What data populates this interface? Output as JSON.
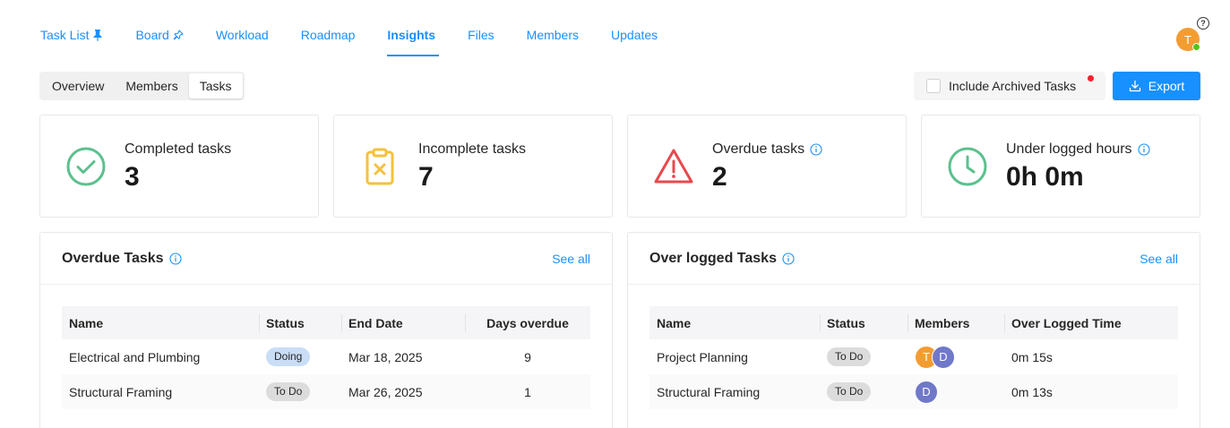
{
  "nav": {
    "tabs": [
      {
        "label": "Task List",
        "pinned": true,
        "pin_style": "solid"
      },
      {
        "label": "Board",
        "pinned": true,
        "pin_style": "outline"
      },
      {
        "label": "Workload"
      },
      {
        "label": "Roadmap"
      },
      {
        "label": "Insights",
        "active": true
      },
      {
        "label": "Files"
      },
      {
        "label": "Members"
      },
      {
        "label": "Updates"
      }
    ],
    "help_glyph": "?",
    "user_initial": "T"
  },
  "segments": {
    "items": [
      "Overview",
      "Members",
      "Tasks"
    ],
    "active": "Tasks"
  },
  "toolbar": {
    "archived_label": "Include Archived Tasks",
    "archived_checked": false,
    "export_label": "Export"
  },
  "stats": [
    {
      "label": "Completed tasks",
      "value": "3",
      "icon": "check-circle-icon",
      "color": "#5cc08e",
      "info": false
    },
    {
      "label": "Incomplete tasks",
      "value": "7",
      "icon": "clipboard-x-icon",
      "color": "#f5c13c",
      "info": false
    },
    {
      "label": "Overdue tasks",
      "value": "2",
      "icon": "warning-triangle-icon",
      "color": "#e8484d",
      "info": true
    },
    {
      "label": "Under logged hours",
      "value": "0h 0m",
      "icon": "clock-icon",
      "color": "#5cc08e",
      "info": true
    }
  ],
  "overdue_panel": {
    "title": "Overdue Tasks",
    "see_all": "See all",
    "columns": [
      "Name",
      "Status",
      "End Date",
      "Days overdue"
    ],
    "rows": [
      {
        "name": "Electrical and Plumbing",
        "status": "Doing",
        "end_date": "Mar 18, 2025",
        "days": "9"
      },
      {
        "name": "Structural Framing",
        "status": "To Do",
        "end_date": "Mar 26, 2025",
        "days": "1"
      }
    ]
  },
  "overlogged_panel": {
    "title": "Over logged Tasks",
    "see_all": "See all",
    "columns": [
      "Name",
      "Status",
      "Members",
      "Over Logged Time"
    ],
    "rows": [
      {
        "name": "Project Planning",
        "status": "To Do",
        "members": [
          {
            "initial": "T",
            "color": "#f39c32"
          },
          {
            "initial": "D",
            "color": "#7078c9"
          }
        ],
        "time": "0m 15s"
      },
      {
        "name": "Structural Framing",
        "status": "To Do",
        "members": [
          {
            "initial": "D",
            "color": "#7078c9"
          }
        ],
        "time": "0m 13s"
      }
    ]
  },
  "colors": {
    "accent": "#1890ff",
    "online": "#52c41a",
    "notification": "#f5222d"
  }
}
